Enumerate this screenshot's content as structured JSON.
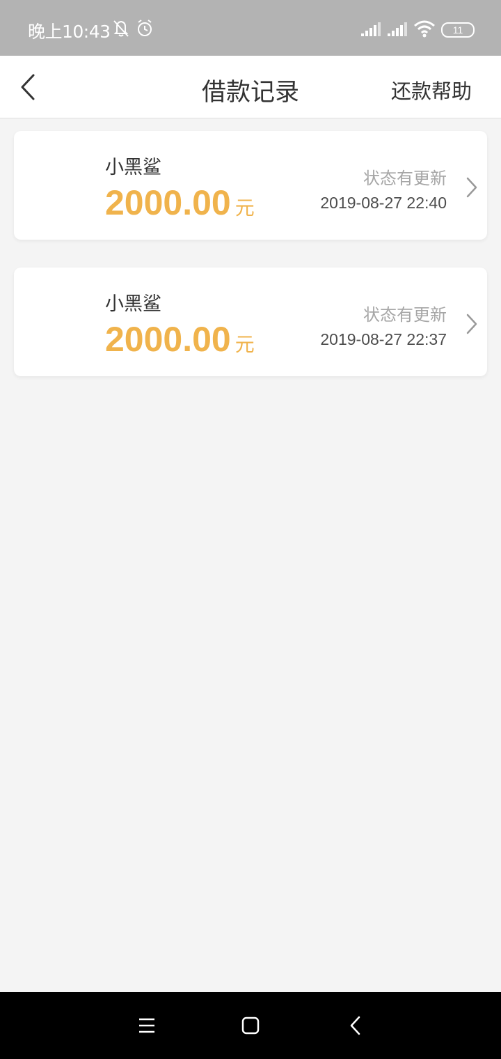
{
  "status_bar": {
    "time": "晚上10:43",
    "icons": [
      "bell-off-icon",
      "alarm-icon",
      "signal-icon",
      "signal-icon",
      "wifi-icon"
    ],
    "battery": "11"
  },
  "header": {
    "title": "借款记录",
    "help_label": "还款帮助",
    "back_icon": "back-arrow-icon"
  },
  "loans": [
    {
      "lender": "小黑鲨",
      "amount": "2000.00",
      "unit": "元",
      "status": "状态有更新",
      "date": "2019-08-27 22:40"
    },
    {
      "lender": "小黑鲨",
      "amount": "2000.00",
      "unit": "元",
      "status": "状态有更新",
      "date": "2019-08-27 22:37"
    }
  ],
  "nav_bar": {
    "icons": [
      "menu-icon",
      "home-icon",
      "back-icon"
    ]
  },
  "colors": {
    "amount": "#f0b34c",
    "status_bar": "#b3b3b3",
    "background": "#f4f4f4"
  }
}
